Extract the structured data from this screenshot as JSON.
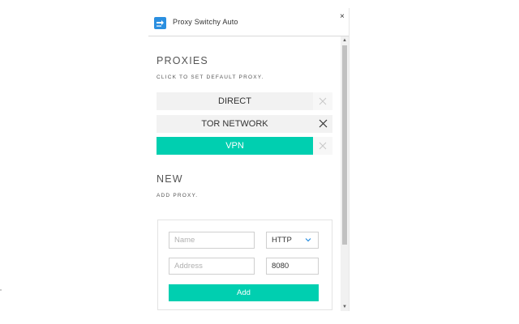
{
  "window": {
    "title": "Proxy Switchy Auto",
    "close_label": "×",
    "app_icon": "arrow-switch-icon"
  },
  "proxies_section": {
    "title": "PROXIES",
    "subtitle": "CLICK TO SET DEFAULT PROXY.",
    "items": [
      {
        "label": "DIRECT",
        "active": false
      },
      {
        "label": "TOR NETWORK",
        "active": false
      },
      {
        "label": "VPN",
        "active": true
      }
    ]
  },
  "new_section": {
    "title": "NEW",
    "subtitle": "ADD PROXY.",
    "form": {
      "name_placeholder": "Name",
      "protocol_value": "HTTP",
      "address_placeholder": "Address",
      "port_value": "8080",
      "add_label": "Add"
    }
  },
  "colors": {
    "accent": "#00cfb0",
    "icon_blue": "#2b8fe0",
    "row_bg": "#f2f2f2"
  }
}
